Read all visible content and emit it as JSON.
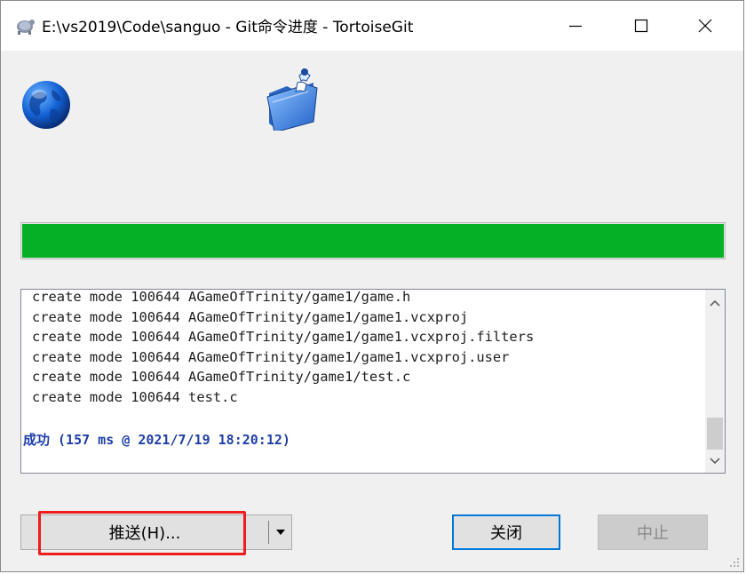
{
  "window": {
    "title": "E:\\vs2019\\Code\\sanguo - Git命令进度 - TortoiseGit",
    "icons": [
      "tortoise-icon",
      "minimize-icon",
      "maximize-icon",
      "close-icon"
    ]
  },
  "progress": {
    "value": 1.0,
    "color": "#06b025"
  },
  "log": {
    "lines": [
      "create mode 100644 AGameOfTrinity/game1/game.h",
      "create mode 100644 AGameOfTrinity/game1/game1.vcxproj",
      "create mode 100644 AGameOfTrinity/game1/game1.vcxproj.filters",
      "create mode 100644 AGameOfTrinity/game1/game1.vcxproj.user",
      "create mode 100644 AGameOfTrinity/game1/test.c",
      "create mode 100644 test.c"
    ],
    "success": "成功 (157 ms @ 2021/7/19 18:20:12)",
    "success_color": "#1f3fa8"
  },
  "buttons": {
    "push": "推送(H)...",
    "close": "关闭",
    "abort": "中止"
  },
  "colors": {
    "highlight": "#ee1c1c",
    "accent": "#0078d7"
  }
}
